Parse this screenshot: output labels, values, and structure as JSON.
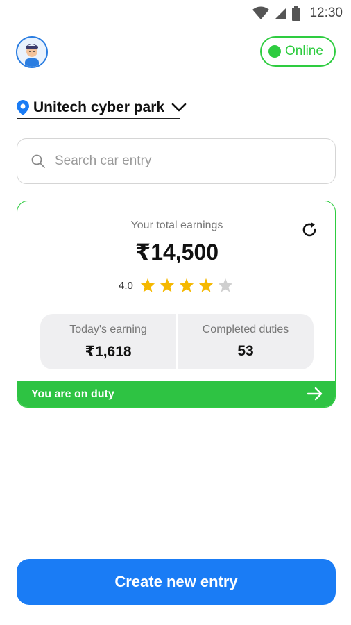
{
  "status_bar": {
    "time": "12:30",
    "icons": [
      "wifi-icon",
      "cell-signal-icon",
      "battery-icon"
    ]
  },
  "header": {
    "avatar_icon": "user-avatar-icon",
    "status_label": "Online",
    "status_color": "#2ecc40"
  },
  "location": {
    "name": "Unitech cyber park",
    "icon": "location-pin-icon"
  },
  "search": {
    "placeholder": "Search car entry",
    "value": ""
  },
  "earnings_card": {
    "title": "Your total earnings",
    "total": "₹14,500",
    "rating": "4.0",
    "stars_filled": 4,
    "stars_total": 5,
    "today_label": "Today's earning",
    "today_value": "₹1,618",
    "duties_label": "Completed duties",
    "duties_value": "53",
    "duty_status": "You are on duty"
  },
  "actions": {
    "create_label": "Create new entry"
  },
  "colors": {
    "accent_blue": "#1a7cf5",
    "accent_green": "#2ec343",
    "star_yellow": "#f5b800",
    "star_grey": "#cfcfcf"
  }
}
